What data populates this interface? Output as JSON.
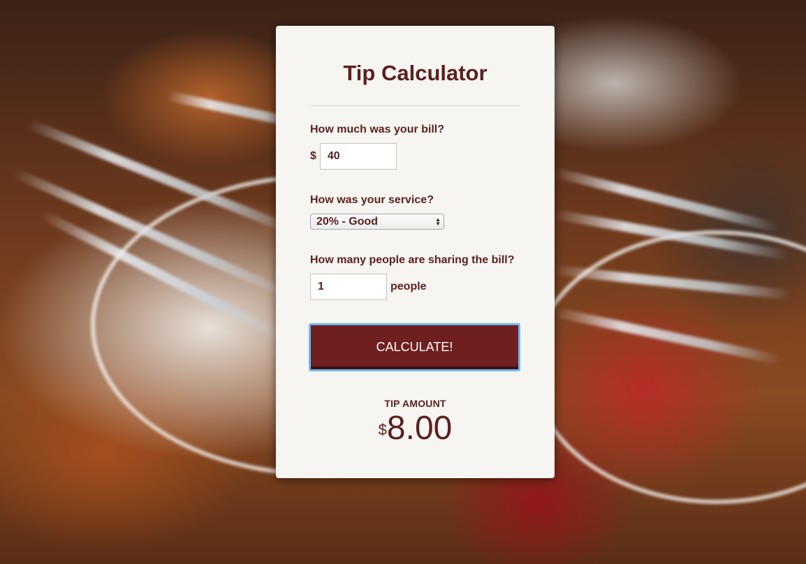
{
  "page": {
    "title": "Tip Calculator"
  },
  "bill": {
    "label": "How much was your bill?",
    "currency": "$",
    "value": "40"
  },
  "service": {
    "label": "How was your service?",
    "selected": "20% - Good"
  },
  "people": {
    "label": "How many people are sharing the bill?",
    "value": "1",
    "unit": "people"
  },
  "calculate": {
    "label": "CALCULATE!"
  },
  "result": {
    "label": "TIP AMOUNT",
    "currency": "$",
    "value": "8.00"
  },
  "colors": {
    "accent": "#5b1f1f",
    "button": "#6f1f1f",
    "focus_ring": "#6cb7f0",
    "card": "#f7f5f1"
  },
  "icons": {
    "select_arrows": "updown-chevron-icon"
  }
}
